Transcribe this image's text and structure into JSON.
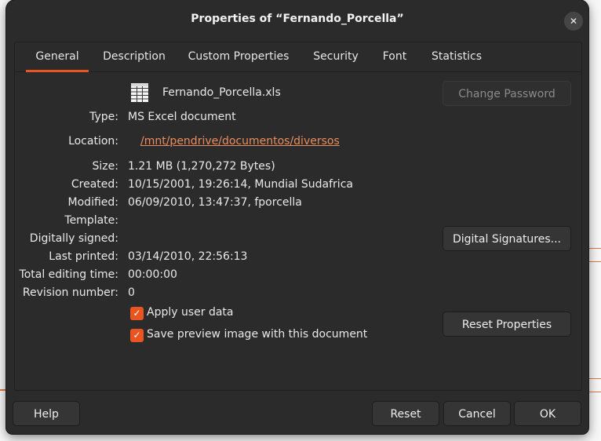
{
  "dialog": {
    "title": "Properties of “Fernando_Porcella”",
    "close_glyph": "✕"
  },
  "tabs": [
    {
      "label": "General",
      "active": true
    },
    {
      "label": "Description"
    },
    {
      "label": "Custom Properties"
    },
    {
      "label": "Security"
    },
    {
      "label": "Font"
    },
    {
      "label": "Statistics"
    }
  ],
  "general": {
    "filename": "Fernando_Porcella.xls",
    "file_icon": "spreadsheet-icon",
    "type_label": "Type:",
    "type_value": "MS Excel document",
    "location_label": "Location:",
    "location_value": "/mnt/pendrive/documentos/diversos",
    "size_label": "Size:",
    "size_value": "1.21 MB (1,270,272 Bytes)",
    "created_label": "Created:",
    "created_value": "10/15/2001, 19:26:14, Mundial Sudafrica",
    "modified_label": "Modified:",
    "modified_value": "06/09/2010, 13:47:37, fporcella",
    "template_label": "Template:",
    "template_value": "",
    "signed_label": "Digitally signed:",
    "signed_value": "",
    "printed_label": "Last printed:",
    "printed_value": "03/14/2010, 22:56:13",
    "editing_label": "Total editing time:",
    "editing_value": "00:00:00",
    "revision_label": "Revision number:",
    "revision_value": "0",
    "apply_user_data": {
      "label": "Apply user data",
      "checked": true
    },
    "save_preview": {
      "label": "Save preview image with this document",
      "checked": true
    },
    "change_password": "Change Password",
    "digital_signatures": "Digital Signatures...",
    "reset_properties": "Reset Properties"
  },
  "footer": {
    "help": "Help",
    "reset": "Reset",
    "cancel": "Cancel",
    "ok": "OK"
  },
  "colors": {
    "accent": "#e95420",
    "link": "#e98d5f",
    "dialog_bg": "#2b2b2b"
  }
}
